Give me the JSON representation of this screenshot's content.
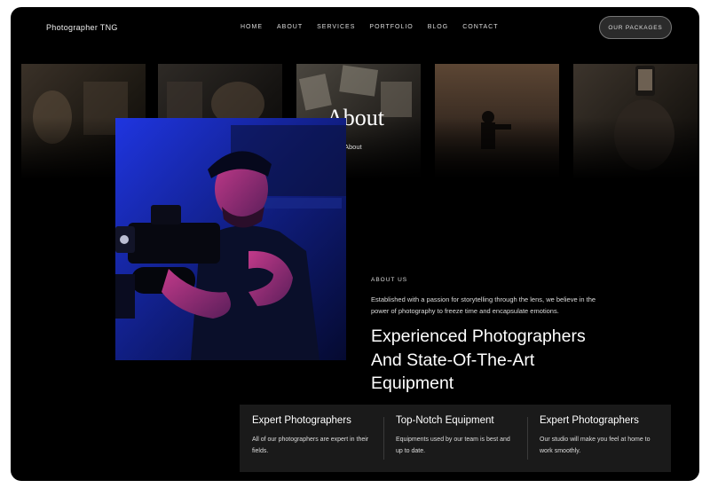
{
  "nav": {
    "brand": "Photographer TNG",
    "items": [
      "HOME",
      "ABOUT",
      "SERVICES",
      "PORTFOLIO",
      "BLOG",
      "CONTACT"
    ],
    "packages_button": "OUR PACKAGES"
  },
  "hero": {
    "title": "About",
    "breadcrumb_current": "About"
  },
  "about": {
    "eyebrow": "ABOUT US",
    "description": "Established with a passion for storytelling through the lens, we believe in the power of photography to freeze time and encapsulate emotions.",
    "heading": "Experienced Photographers And State-Of-The-Art Equipment"
  },
  "features": [
    {
      "title": "Expert Photographers",
      "text": "All of our photographers are expert in their fields."
    },
    {
      "title": "Top-Notch Equipment",
      "text": "Equipments used by our team is best and up to date."
    },
    {
      "title": "Expert Photographers",
      "text": "Our studio will make you feel at home to work smoothly."
    }
  ],
  "colors": {
    "background": "#000000",
    "panel": "#1a1a1a",
    "button_bg": "#2b2b2b",
    "photo_accent": "#1e2fd6"
  }
}
